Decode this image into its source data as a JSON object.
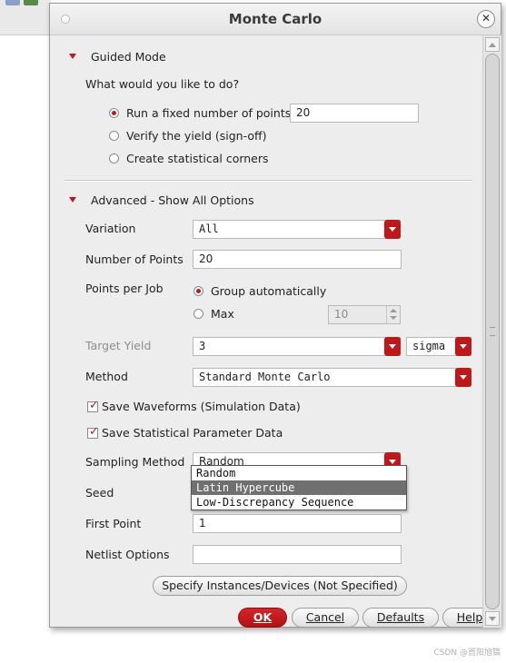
{
  "dialog": {
    "title": "Monte Carlo",
    "close_icon": "close-icon"
  },
  "guided": {
    "header": "Guided Mode",
    "question": "What would you like to do?",
    "options": [
      {
        "label": "Run a fixed number of points",
        "selected": true
      },
      {
        "label": "Verify the yield (sign-off)",
        "selected": false
      },
      {
        "label": "Create statistical corners",
        "selected": false
      }
    ],
    "points_value": "20"
  },
  "advanced": {
    "header": "Advanced - Show All Options",
    "variation": {
      "label": "Variation",
      "value": "All"
    },
    "num_points": {
      "label": "Number of Points",
      "value": "20"
    },
    "points_per_job": {
      "label": "Points per Job",
      "group_auto": "Group automatically",
      "max": "Max",
      "max_value": "10",
      "selected": "group_auto"
    },
    "target_yield": {
      "label": "Target Yield",
      "value": "3",
      "unit": "sigma"
    },
    "method": {
      "label": "Method",
      "value": "Standard Monte Carlo"
    },
    "save_waveforms": {
      "label": "Save Waveforms (Simulation Data)",
      "checked": true
    },
    "save_stat": {
      "label": "Save Statistical Parameter Data",
      "checked": true
    },
    "sampling": {
      "label": "Sampling Method",
      "value": "Random",
      "options": [
        "Random",
        "Latin Hypercube",
        "Low-Discrepancy Sequence"
      ],
      "highlighted": "Latin Hypercube"
    },
    "seed": {
      "label": "Seed",
      "value": ""
    },
    "first_point": {
      "label": "First Point",
      "value": "1"
    },
    "netlist": {
      "label": "Netlist Options",
      "value": ""
    },
    "specify_button": "Specify Instances/Devices (Not Specified)"
  },
  "buttons": {
    "ok": "OK",
    "cancel": "Cancel",
    "defaults": "Defaults",
    "help": "Help"
  },
  "watermark": "CSDN @首阳旭镐",
  "colors": {
    "accent": "#c0171b",
    "highlight": "#707070"
  }
}
